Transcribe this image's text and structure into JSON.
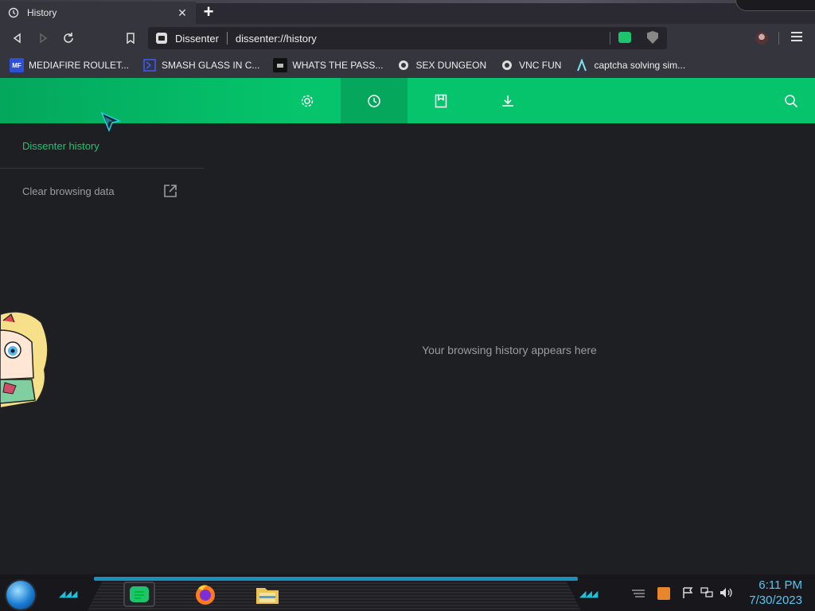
{
  "browser": {
    "tab": {
      "title": "History"
    },
    "address": {
      "site": "Dissenter",
      "url": "dissenter://history"
    }
  },
  "bookmarks": [
    {
      "label": "MEDIAFIRE ROULET...",
      "icon": "mediafire-icon",
      "icon_text": "MF"
    },
    {
      "label": "SMASH GLASS IN C...",
      "icon": "chevron-box-icon"
    },
    {
      "label": "WHATS THE PASS...",
      "icon": "dark-square-icon"
    },
    {
      "label": "SEX DUNGEON",
      "icon": "gear-badge-icon"
    },
    {
      "label": "VNC FUN",
      "icon": "gear-badge-icon"
    },
    {
      "label": "captcha solving sim...",
      "icon": "lambda-icon"
    }
  ],
  "page": {
    "sidebar_title": "Dissenter history",
    "clear_link": "Clear browsing data",
    "empty_message": "Your browsing history appears here"
  },
  "toolbar_icons": [
    "gear-icon",
    "history-icon",
    "bookmark-icon",
    "download-icon",
    "search-icon"
  ],
  "colors": {
    "accent": "#05c46b",
    "accent_dark": "#04a75c",
    "background": "#1e1f22",
    "clock": "#56c7f0"
  },
  "taskbar": {
    "clock": {
      "time": "6:11 PM",
      "date": "7/30/2023"
    }
  }
}
